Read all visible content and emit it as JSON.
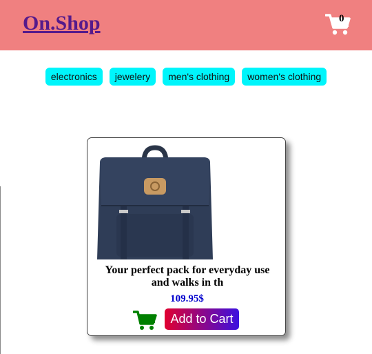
{
  "header": {
    "brand": "On.Shop",
    "cart_count": "0",
    "background": "#f08080"
  },
  "categories": [
    "electronics",
    "jewelery",
    "men's clothing",
    "women's clothing"
  ],
  "product": {
    "title": "Your perfect pack for everyday use and walks in th",
    "price": "109.95$",
    "add_to_cart_label": "Add to Cart",
    "image_icon": "backpack-image",
    "cart_icon": "shopping-cart-icon"
  },
  "colors": {
    "category_bg": "#00f5fb",
    "price": "#0000cd",
    "cart_icon_green": "#008000",
    "button_gradient_start": "#e00030",
    "button_gradient_end": "#3b10e0"
  }
}
